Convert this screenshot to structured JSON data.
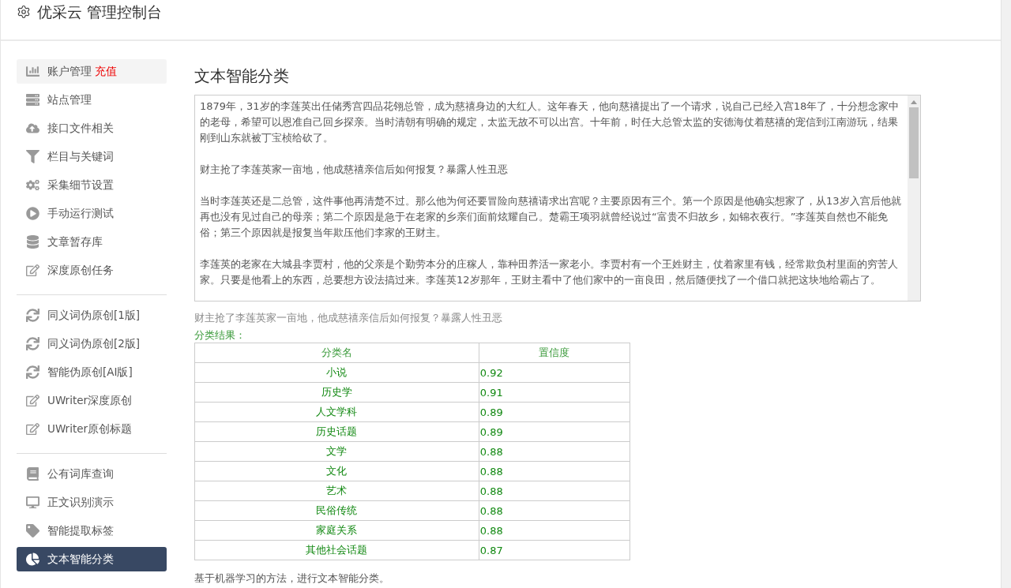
{
  "header": {
    "title": "优采云 管理控制台"
  },
  "sidebar": {
    "groups": [
      [
        {
          "label": "账户管理",
          "badge": "充值",
          "kind": "chart",
          "selected": false
        },
        {
          "label": "站点管理",
          "kind": "server",
          "selected": false
        },
        {
          "label": "接口文件相关",
          "kind": "cloud",
          "selected": false
        },
        {
          "label": "栏目与关键词",
          "kind": "filter",
          "selected": false
        },
        {
          "label": "采集细节设置",
          "kind": "cogs",
          "selected": false
        },
        {
          "label": "手动运行测试",
          "kind": "play",
          "selected": false
        },
        {
          "label": "文章暂存库",
          "kind": "database",
          "selected": false
        },
        {
          "label": "深度原创任务",
          "kind": "edit",
          "selected": false
        }
      ],
      [
        {
          "label": "同义词伪原创[1版]",
          "kind": "sync",
          "selected": false
        },
        {
          "label": "同义词伪原创[2版]",
          "kind": "sync",
          "selected": false
        },
        {
          "label": "智能伪原创[AI版]",
          "kind": "sync",
          "selected": false
        },
        {
          "label": "UWriter深度原创",
          "kind": "edit",
          "selected": false
        },
        {
          "label": "UWriter原创标题",
          "kind": "edit",
          "selected": false
        }
      ],
      [
        {
          "label": "公有词库查询",
          "kind": "book",
          "selected": false
        },
        {
          "label": "正文识别演示",
          "kind": "desktop",
          "selected": false
        },
        {
          "label": "智能提取标签",
          "kind": "tag",
          "selected": false
        },
        {
          "label": "文本智能分类",
          "kind": "pie",
          "selected": true
        }
      ]
    ]
  },
  "main": {
    "title": "文本智能分类",
    "input": {
      "paragraphs": [
        "1879年，31岁的李莲英出任储秀宫四品花翎总管，成为慈禧身边的大红人。这年春天，他向慈禧提出了一个请求，说自己已经入宫18年了，十分想念家中的老母，希望可以恩准自己回乡探亲。当时清朝有明确的规定，太监无故不可以出宫。十年前，时任大总管太监的安德海仗着慈禧的宠信到江南游玩，结果刚到山东就被丁宝桢给砍了。",
        "财主抢了李莲英家一亩地，他成慈禧亲信后如何报复？暴露人性丑恶",
        "当时李莲英还是二总管，这件事他再清楚不过。那么他为何还要冒险向慈禧请求出宫呢？主要原因有三个。第一个原因是他确实想家了，从13岁入宫后他就再也没有见过自己的母亲；第二个原因是急于在老家的乡亲们面前炫耀自己。楚霸王项羽就曾经说过“富贵不归故乡，如锦衣夜行。”李莲英自然也不能免俗；第三个原因就是报复当年欺压他们李家的王财主。",
        "李莲英的老家在大城县李贾村，他的父亲是个勤劳本分的庄稼人，靠种田养活一家老小。李贾村有一个王姓财主，仗着家里有钱，经常欺负村里面的穷苦人家。只要是他看上的东西，总要想方设法搞过来。李莲英12岁那年，王财主看中了他们家中的一亩良田，然后随便找了一个借口就把这块地给霸占了。"
      ]
    },
    "article_title": "财主抢了李莲英家一亩地，他成慈禧亲信后如何报复？暴露人性丑恶",
    "result_label": "分类结果：",
    "table": {
      "columns": [
        "分类名",
        "置信度"
      ],
      "rows": [
        [
          "小说",
          "0.92"
        ],
        [
          "历史学",
          "0.91"
        ],
        [
          "人文学科",
          "0.89"
        ],
        [
          "历史话题",
          "0.89"
        ],
        [
          "文学",
          "0.88"
        ],
        [
          "文化",
          "0.88"
        ],
        [
          "艺术",
          "0.88"
        ],
        [
          "民俗传统",
          "0.88"
        ],
        [
          "家庭关系",
          "0.88"
        ],
        [
          "其他社会话题",
          "0.87"
        ]
      ]
    },
    "note": "基于机器学习的方法，进行文本智能分类。"
  }
}
